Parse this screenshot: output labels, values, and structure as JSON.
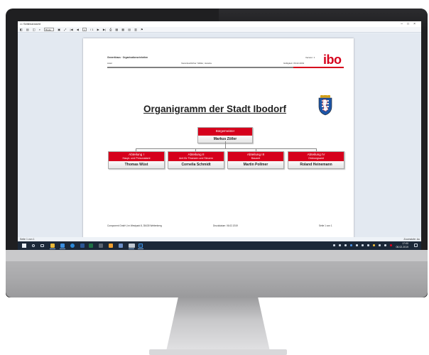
{
  "window": {
    "title": "Seitenansicht",
    "controls": [
      "–",
      "□",
      "×"
    ]
  },
  "toolbar": {
    "zoom_value": "Breite",
    "page_value": "1",
    "page_total": "/ 1",
    "buttons": [
      "◧",
      "▤",
      "◫",
      "⌕",
      "▣",
      "⤢",
      "|◀",
      "◀",
      "▶",
      "▶|",
      "⎙",
      "▦",
      "▦",
      "▤",
      "▥",
      "⚑"
    ]
  },
  "report": {
    "header_left_bold": "Gewerkhaus · Organisationseinheiten",
    "header_left": "Autor",
    "header_center": "Verantwortlicher: Müller, Jessica",
    "header_version": "Version: 1",
    "header_valid": "Gültigkeit: 06.02.2019",
    "logo": "ibo",
    "title": "Organigramm der Stadt Ibodorf",
    "top_box": {
      "dept": "Bürgermeister",
      "name": "Markus Zöller"
    },
    "departments": [
      {
        "dept": "Abteilung I",
        "sub": "Haupt- und Personalamt",
        "name": "Thomas Wüst"
      },
      {
        "dept": "Abteilung II",
        "sub": "Amt für Finanzen und Steuern",
        "name": "Cornelia Schmidt"
      },
      {
        "dept": "Abteilung III",
        "sub": "Bauamt",
        "name": "Martin Pollmer"
      },
      {
        "dept": "Abteilung IV",
        "sub": "Ordnungsamt",
        "name": "Roland Heinemann"
      }
    ],
    "footer_left": "Component GmbH, Im Westpark 8, 35435 Wettenberg",
    "footer_center": "Druckdatum: 06.02.2019",
    "footer_right": "Seite 1 von 1"
  },
  "statusbar": {
    "left": "Seite 1 von 1",
    "right": "Zoomstufe: Au"
  },
  "taskbar": {
    "time": "17:00",
    "date": "06.02.2019"
  },
  "colors": {
    "accent_red": "#d6001c",
    "taskbar": "#1b2838",
    "bezel": "#1f1f21"
  }
}
